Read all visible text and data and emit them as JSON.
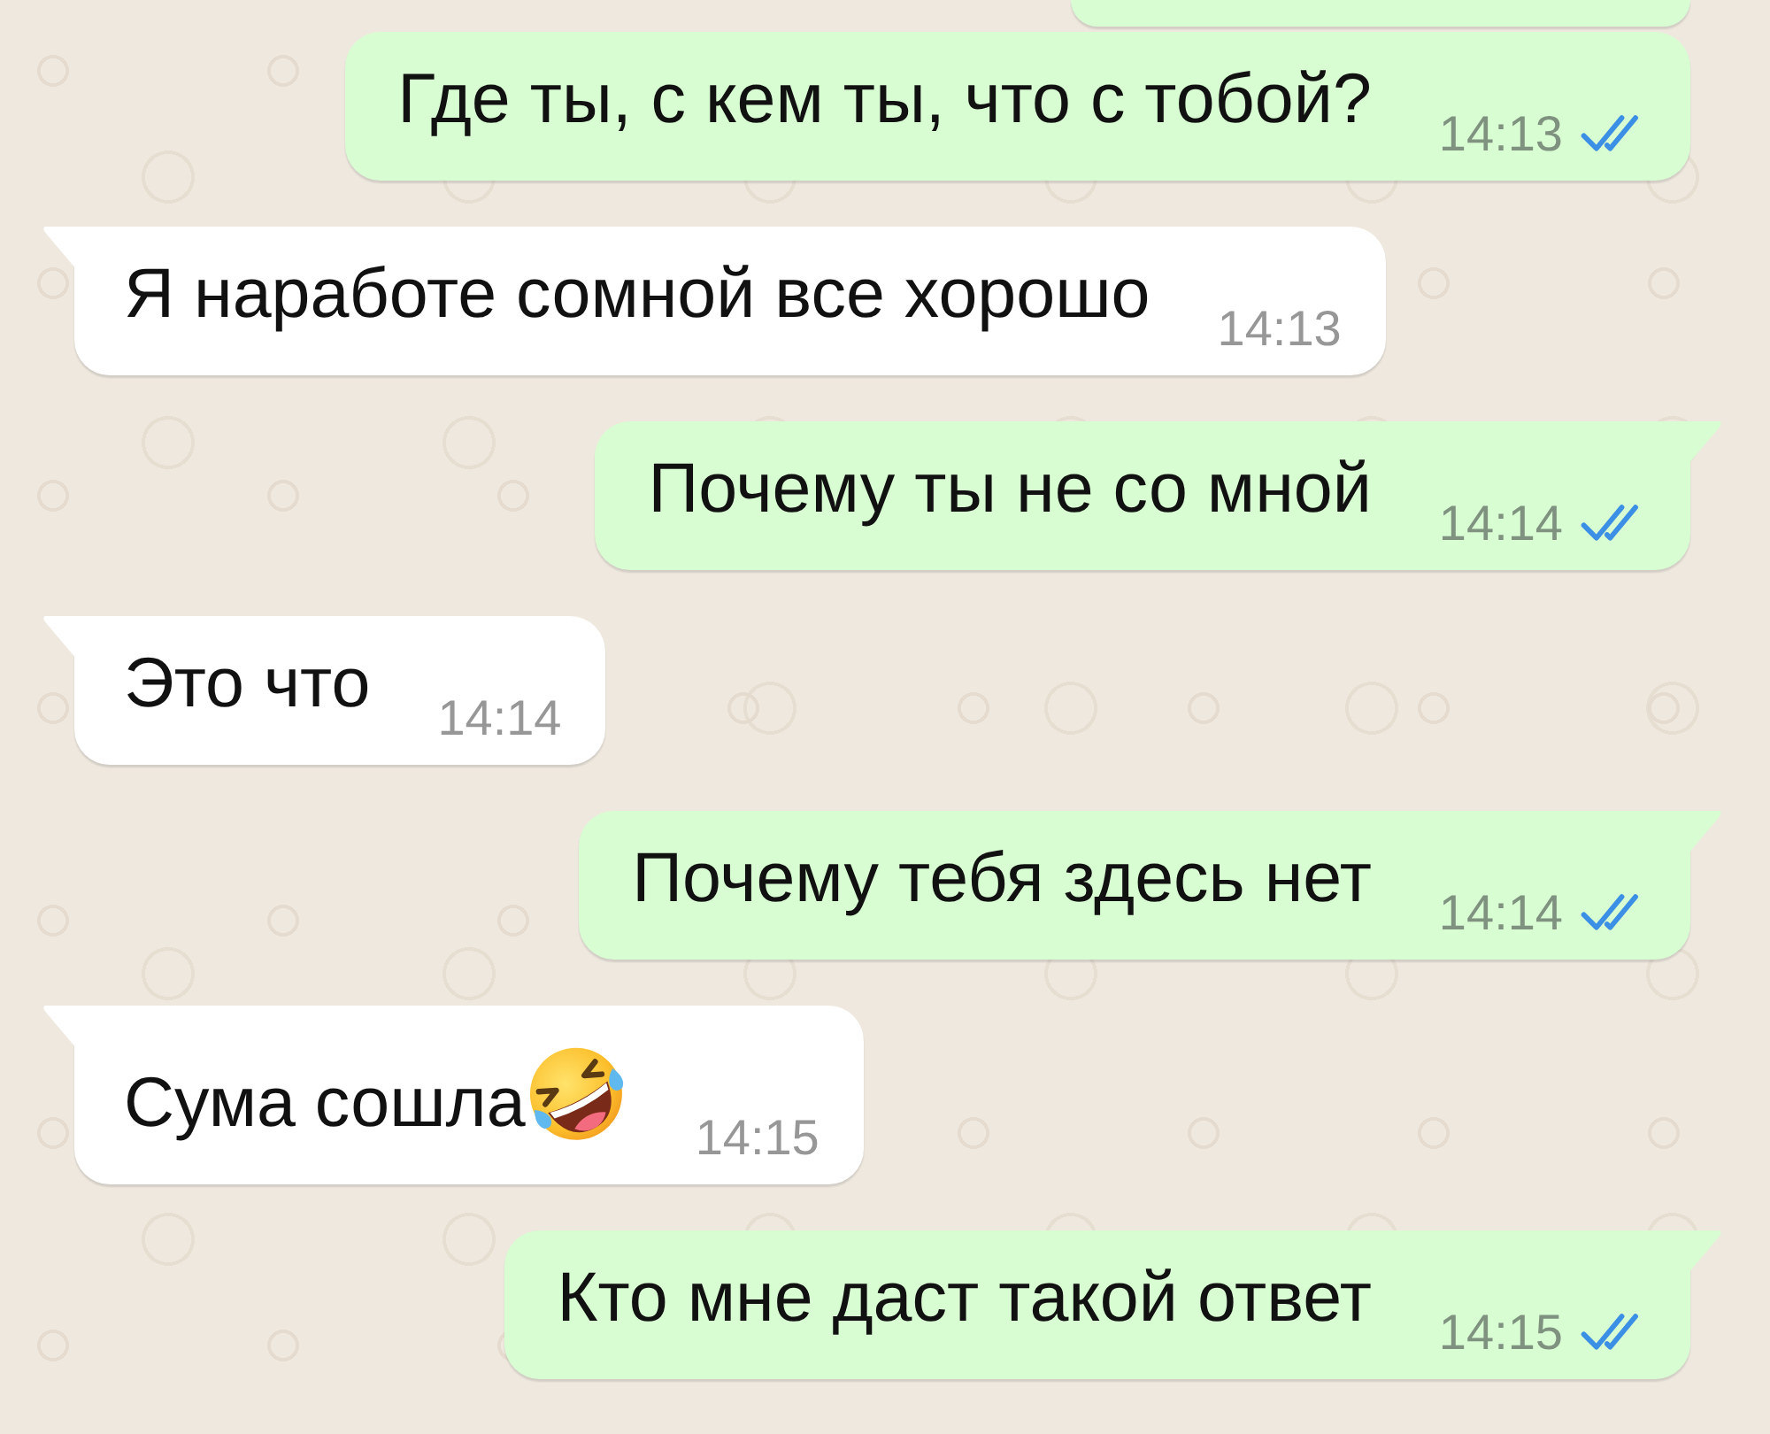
{
  "clipped_bubble_above": {
    "kind": "outgoing"
  },
  "messages": [
    {
      "kind": "outgoing",
      "text": "Где ты, с кем ты, что с тобой?",
      "time": "14:13",
      "read": true
    },
    {
      "kind": "incoming",
      "text": "Я наработе сомной все хорошо",
      "time": "14:13"
    },
    {
      "kind": "outgoing",
      "text": "Почему ты не со мной",
      "time": "14:14",
      "read": true
    },
    {
      "kind": "incoming",
      "text": "Это что",
      "time": "14:14"
    },
    {
      "kind": "outgoing",
      "text": "Почему тебя здесь нет",
      "time": "14:14",
      "read": true
    },
    {
      "kind": "incoming",
      "text": "Сума сошла",
      "emoji": true,
      "time": "14:15"
    },
    {
      "kind": "outgoing",
      "text": "Кто мне даст такой ответ",
      "time": "14:15",
      "read": true
    }
  ]
}
